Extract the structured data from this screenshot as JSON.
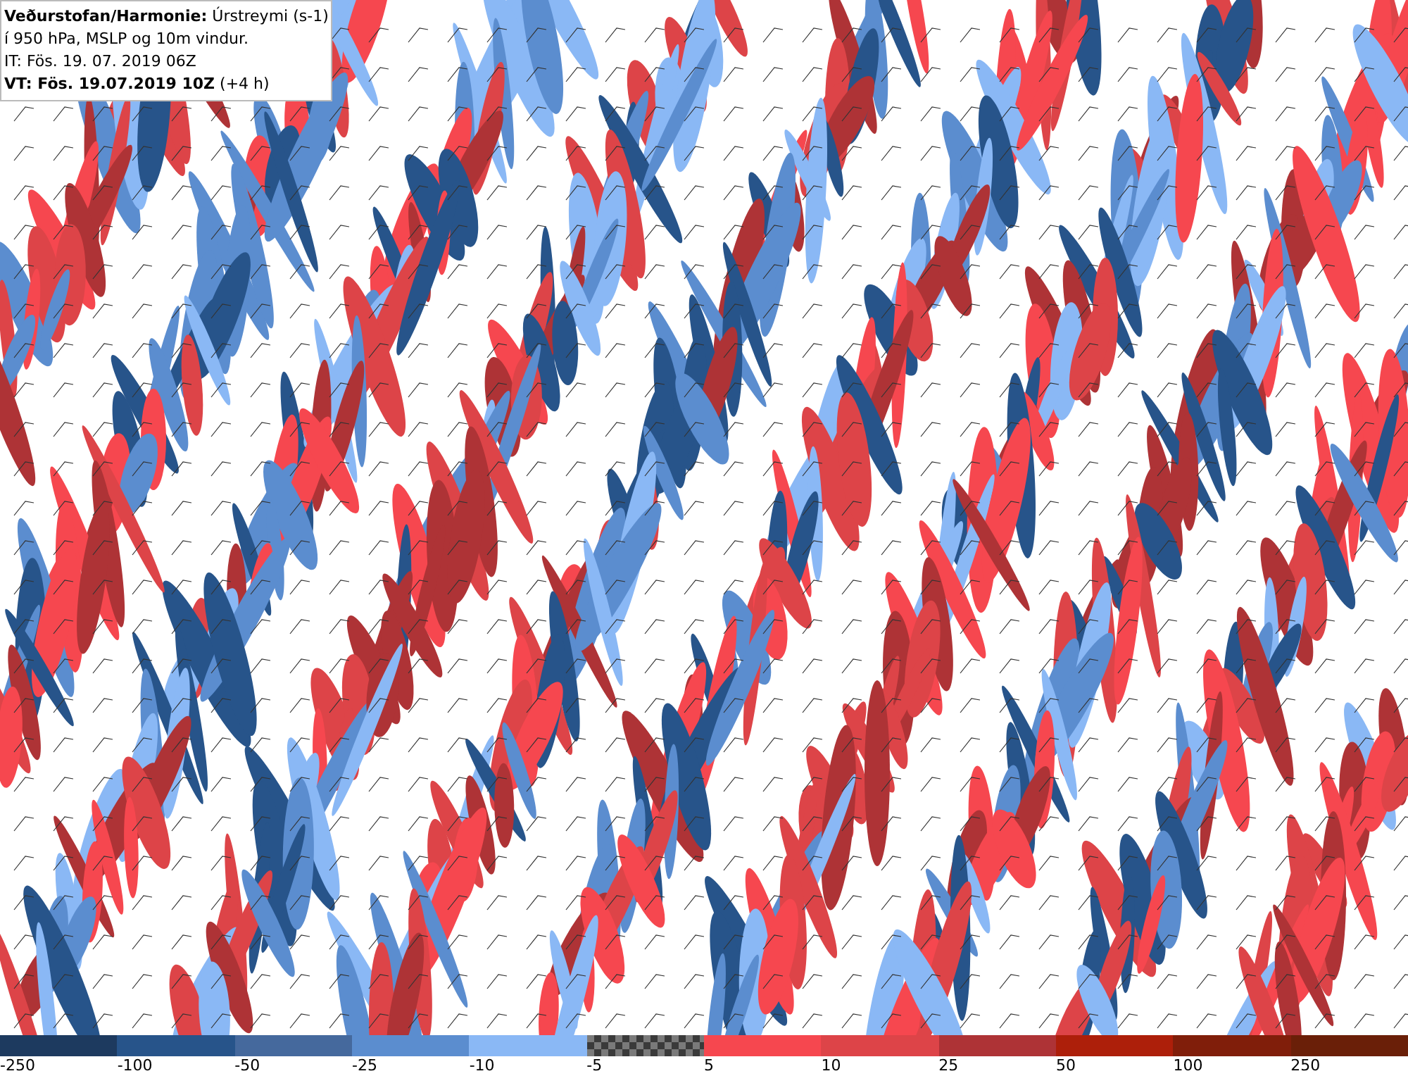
{
  "header": {
    "lines": [
      "**Veðurstofan/Harmonie:** Úrstreymi (s-1)",
      "í 950 hPa, MSLP og 10m vindur.",
      "IT: Fös. 19. 07. 2019 06Z",
      "**VT: Fös. 19.07.2019 10Z** (+4 h)"
    ]
  },
  "legend": [
    {
      "label": "-250",
      "color": "#1d3a5f",
      "kind": "solid"
    },
    {
      "label": "-100",
      "color": "#27548a",
      "kind": "solid"
    },
    {
      "label": "-50",
      "color": "#45699d",
      "kind": "solid"
    },
    {
      "label": "-25",
      "color": "#5b8dcf",
      "kind": "solid"
    },
    {
      "label": "-10",
      "color": "#8ab8f5",
      "kind": "solid"
    },
    {
      "label": "-5",
      "color": "#7a7a7a",
      "kind": "checker"
    },
    {
      "label": "5",
      "color": "#f6474f",
      "kind": "solid"
    },
    {
      "label": "10",
      "color": "#dd4448",
      "kind": "solid"
    },
    {
      "label": "25",
      "color": "#ae3336",
      "kind": "solid"
    },
    {
      "label": "50",
      "color": "#ad1f0a",
      "kind": "solid"
    },
    {
      "label": "100",
      "color": "#801e0a",
      "kind": "solid"
    },
    {
      "label": "250",
      "color": "#6a1f08",
      "kind": "solid"
    }
  ]
}
